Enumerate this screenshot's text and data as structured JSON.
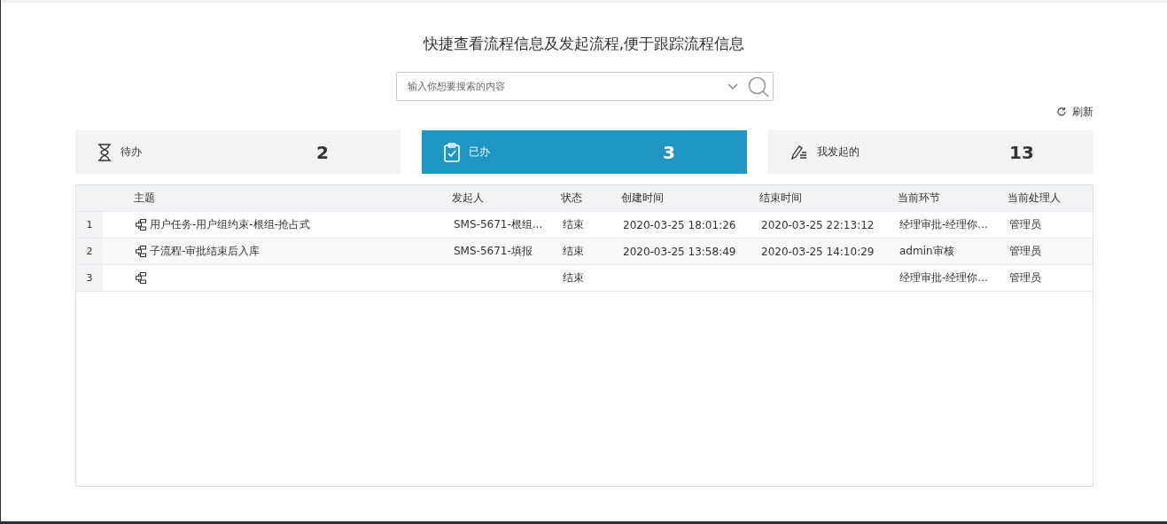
{
  "header": {
    "title": "快捷查看流程信息及发起流程,便于跟踪流程信息"
  },
  "search": {
    "placeholder": "输入你想要搜索的内容"
  },
  "refresh": {
    "label": "刷新"
  },
  "cards": [
    {
      "kind": "hourglass",
      "label": "待办",
      "count": "2",
      "selected": false
    },
    {
      "kind": "clipboard",
      "label": "已办",
      "count": "3",
      "selected": true
    },
    {
      "kind": "pen",
      "label": "我发起的",
      "count": "13",
      "selected": false
    }
  ],
  "table": {
    "columns": [
      "主题",
      "发起人",
      "状态",
      "创建时间",
      "结束时间",
      "当前环节",
      "当前处理人"
    ],
    "rows": [
      {
        "index": "1",
        "cells": [
          "用户任务-用户组约束-根组-抢占式",
          "SMS-5671-根组...",
          "结束",
          "2020-03-25 18:01:26",
          "2020-03-25 22:13:12",
          "经理审批-经理你...",
          "管理员"
        ]
      },
      {
        "index": "2",
        "cells": [
          "子流程-审批结束后入库",
          "SMS-5671-填报",
          "结束",
          "2020-03-25 13:58:49",
          "2020-03-25 14:10:29",
          "admin审核",
          "管理员"
        ]
      },
      {
        "index": "3",
        "cells": [
          "",
          "",
          "结束",
          "",
          "",
          "经理审批-经理你...",
          "管理员"
        ]
      }
    ]
  }
}
